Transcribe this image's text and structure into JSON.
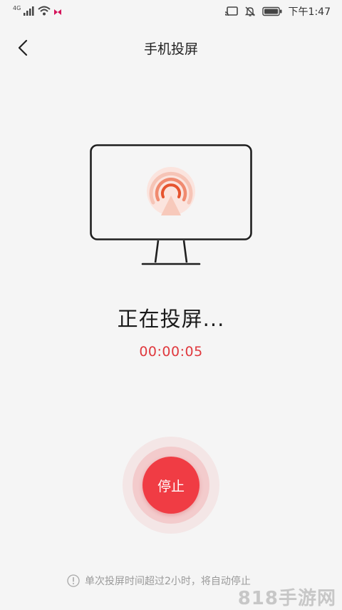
{
  "status_bar": {
    "network_label": "4G",
    "time": "下午1:47"
  },
  "header": {
    "title": "手机投屏",
    "back_icon": "chevron-left-icon"
  },
  "cast_status": {
    "title": "正在投屏...",
    "elapsed": "00:00:05"
  },
  "stop_button": {
    "label": "停止"
  },
  "notice": {
    "text": "单次投屏时间超过2小时，将自动停止",
    "icon": "exclamation-circle-icon"
  },
  "watermark": {
    "text": "818手游网"
  },
  "colors": {
    "accent": "#f03c44",
    "timer": "#e0383d",
    "background": "#f5f5f5"
  }
}
